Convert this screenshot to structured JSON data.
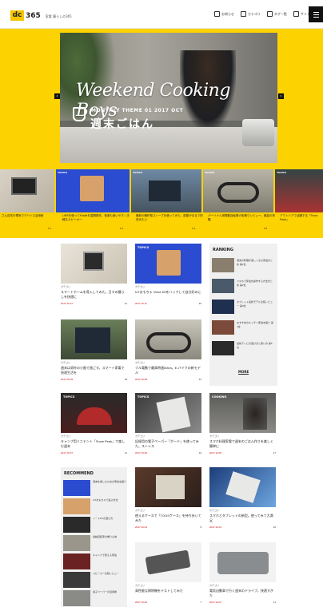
{
  "header": {
    "logo_mark": "dc",
    "logo_num": "365",
    "tagline": "家電 暮らしの365",
    "nav": [
      {
        "label": "お知らせ"
      },
      {
        "label": "カテゴリ"
      },
      {
        "label": "タグ一覧"
      },
      {
        "label": "サイト内検索"
      }
    ]
  },
  "hero": {
    "title": "Weekend Cooking Boys",
    "theme": "MONTHLY THEME 01 2017 OCT",
    "jp_title": "週末ごはん",
    "prev_arrow": "‹",
    "next_arrow": "›"
  },
  "carousel": {
    "items": [
      {
        "tag": "",
        "caption": "さん自宅の電気でデバイス活用術",
        "date": "6.1"
      },
      {
        "tag": "TOPICS",
        "caption": "LINEを使ってKindleを遠隔操作。音楽も使いやすく手軽なスピーカー",
        "date": "6.2"
      },
      {
        "tag": "TOPICS",
        "caption": "最新の暖炉型ストーブを使ってみた。部屋がまるで別荘みたい",
        "date": "6.4"
      },
      {
        "tag": "TOPICS",
        "caption": "パーソナル用電動自転車の街乗りレビュー。最高の体験",
        "date": "6.5"
      },
      {
        "tag": "TOPICS",
        "caption": "アウトドアで活躍する「Snow Peak」",
        "date": "6.6"
      }
    ]
  },
  "cards": [
    {
      "tag": "",
      "cat": "カテゴリ",
      "title": "スマートホームを導入してみた。日々の暮らしを快適に",
      "date": "2017.10.12",
      "count": "12"
    },
    {
      "tag": "TOPICS",
      "cat": "カテゴリ",
      "title": "IoTおもちゃ Voice Kitをハックして自分好みに",
      "date": "2017.10.11",
      "count": "35"
    },
    {
      "tag": "",
      "cat": "カテゴリ",
      "title": "週末は郊外の小屋で過ごす。スマート家電で快適生活を",
      "date": "2017.10.09",
      "count": "18"
    },
    {
      "tag": "",
      "cat": "カテゴリ",
      "title": "フル電動で最高時速60km。E-バイクの新モデル",
      "date": "2017.10.08",
      "count": "22"
    },
    {
      "tag": "TOPICS",
      "cat": "カテゴリ",
      "title": "キャンプ用ミニテント「Snow Peak」で楽しむ週末",
      "date": "2017.10.07",
      "count": "14"
    },
    {
      "tag": "TOPICS",
      "cat": "カテゴリ",
      "title": "記録用の電子ペーパー「ボード」を使ってみた。ストレス",
      "date": "2017.10.06",
      "count": "19"
    },
    {
      "tag": "COOKING",
      "cat": "カテゴリ",
      "title": "スマホ料理家電で週末のごはん作りを楽しく簡単に",
      "date": "2017.10.05",
      "count": "27"
    },
    {
      "tag": "",
      "cat": "カテゴリ",
      "title": "使えるケースで「TOOSケース」を持ち歩いてみた",
      "date": "2017.10.04",
      "count": "9"
    },
    {
      "tag": "",
      "cat": "カテゴリ",
      "title": "スマホとタブレットの新型。使ってみて大満足",
      "date": "2017.10.03",
      "count": "16"
    },
    {
      "tag": "",
      "cat": "カテゴリ",
      "title": "高性能な掃除機をテストしてみた",
      "date": "2017.10.02",
      "count": "7"
    },
    {
      "tag": "",
      "cat": "カテゴリ",
      "title": "電気自動車で行く週末のドライブ。快適すぎた",
      "date": "2017.10.01",
      "count": "11"
    }
  ],
  "ranking": {
    "heading": "RANKING",
    "items": [
      {
        "text": "週末の料理が楽しくなる家電まとめ 第1位"
      },
      {
        "text": "スマホで家電を操作する方法まとめ 第2位"
      },
      {
        "text": "タブレット最新モデル比較レビュー 第3位"
      },
      {
        "text": "おすすめのキッチン家電を紹介 第4位"
      },
      {
        "text": "最新テレビの選び方と使い方 第5位"
      }
    ],
    "more": "MORE"
  },
  "recommend": {
    "heading": "RECOMMEND",
    "items": [
      {
        "text": "週末を楽しむための家電を紹介"
      },
      {
        "text": "IoTおもちゃで遊ぶ方法"
      },
      {
        "text": "ノートPCの選び方"
      },
      {
        "text": "電動自転車の乗り心地"
      },
      {
        "text": "キャンプで使える家電"
      },
      {
        "text": "スピーカー比較レビュー"
      },
      {
        "text": "電子ペーパーの活用術"
      }
    ]
  }
}
